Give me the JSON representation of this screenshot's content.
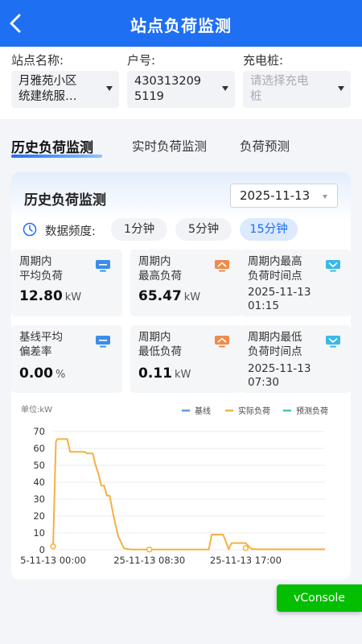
{
  "header": {
    "title": "站点负荷监测"
  },
  "filters": {
    "station": {
      "label": "站点名称:",
      "value_line1": "月雅苑小区",
      "value_line2": "统建统服…"
    },
    "account": {
      "label": "户号:",
      "value_line1": "430313209",
      "value_line2": "5119"
    },
    "charger": {
      "label": "充电桩:",
      "placeholder_line1": "请选择充电",
      "placeholder_line2": "桩"
    }
  },
  "tabs": [
    {
      "label": "历史负荷监测",
      "active": true
    },
    {
      "label": "实时负荷监测",
      "active": false
    },
    {
      "label": "负荷预测",
      "active": false
    }
  ],
  "card": {
    "title": "历史负荷监测",
    "date": "2025-11-13",
    "frequency_label": "数据频度:",
    "frequency_options": [
      "1分钟",
      "5分钟",
      "15分钟"
    ],
    "frequency_selected": "15分钟",
    "stats": [
      {
        "label_line1": "周期内",
        "label_line2": "平均负荷",
        "value": "12.80",
        "unit": "kW",
        "icon": "monitor-icon",
        "icon_color": "#3b8de8"
      },
      {
        "label_line1": "周期内",
        "label_line2": "最高负荷",
        "value": "65.47",
        "unit": "kW",
        "icon": "peak-up-icon",
        "icon_color": "#f08a4b"
      },
      {
        "label_line1": "周期内最高",
        "label_line2": "负荷时间点",
        "time_line1": "2025-11-13",
        "time_line2": "01:15",
        "icon": "time-down-icon",
        "icon_color": "#3ab8e8"
      },
      {
        "label_line1": "基线平均",
        "label_line2": "偏差率",
        "value": "0.00",
        "unit": "%",
        "icon": "monitor-icon",
        "icon_color": "#3b8de8"
      },
      {
        "label_line1": "周期内",
        "label_line2": "最低负荷",
        "value": "0.11",
        "unit": "kW",
        "icon": "peak-up-icon",
        "icon_color": "#f08a4b"
      },
      {
        "label_line1": "周期内最低",
        "label_line2": "负荷时间点",
        "time_line1": "2025-11-13",
        "time_line2": "07:30",
        "icon": "time-down-icon",
        "icon_color": "#3ab8e8"
      }
    ]
  },
  "chart_data": {
    "type": "line",
    "unit_label": "单位:kW",
    "ylim": [
      0,
      70
    ],
    "y_ticks": [
      0,
      10,
      20,
      30,
      40,
      50,
      60,
      70
    ],
    "xlim": [
      0,
      96
    ],
    "x_tick_labels": [
      {
        "pos": 0,
        "text": "5-11-13 00:00"
      },
      {
        "pos": 34,
        "text": "25-11-13 08:30"
      },
      {
        "pos": 68,
        "text": "25-11-13 17:00"
      }
    ],
    "legend_position": "top-right",
    "colors": {
      "baseline": "#5b9be6",
      "actual": "#f5b041",
      "forecast": "#3fc6c0"
    },
    "series": [
      {
        "name": "基线",
        "values": []
      },
      {
        "name": "实际负荷",
        "x": [
          0,
          1,
          1.5,
          5,
          6,
          11,
          12,
          14,
          15,
          16,
          17,
          18,
          19,
          20,
          21,
          22,
          23,
          25,
          26,
          27,
          28,
          30,
          34,
          40,
          50,
          55,
          56,
          60,
          61,
          62,
          63,
          64,
          68,
          70,
          72,
          75,
          78,
          80,
          96
        ],
        "y": [
          2,
          64,
          65.5,
          65.5,
          58,
          58,
          57,
          57,
          50,
          45,
          38,
          38,
          32,
          32,
          23,
          15,
          8,
          1,
          0.5,
          0.3,
          0.2,
          0.2,
          0.2,
          0.2,
          0.2,
          0.2,
          9,
          9,
          5,
          0.3,
          4,
          4,
          4,
          0.5,
          0.3,
          0.3,
          0.3,
          0.3,
          0.3
        ],
        "markers": [
          [
            0,
            2
          ],
          [
            34,
            0.2
          ],
          [
            68,
            1
          ]
        ]
      },
      {
        "name": "预测负荷",
        "values": []
      }
    ]
  },
  "vconsole": {
    "label": "vConsole"
  }
}
